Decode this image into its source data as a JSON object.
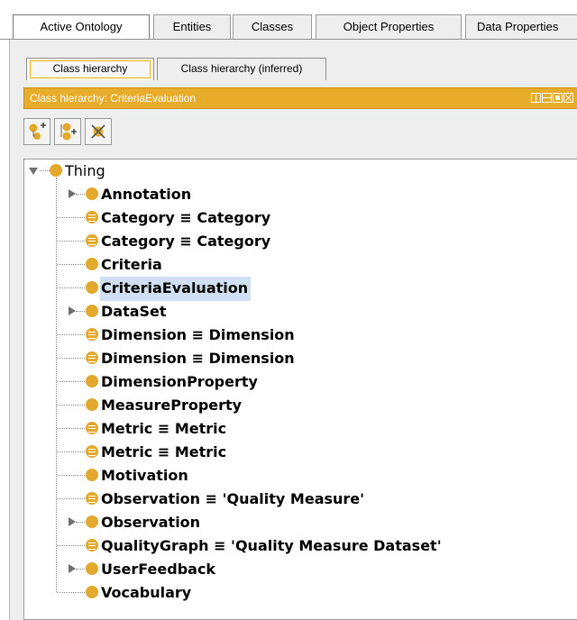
{
  "top_tabs": [
    "Active Ontology",
    "Entities",
    "Classes",
    "Object Properties",
    "Data Properties"
  ],
  "inner_tabs": [
    "Class hierarchy",
    "Class hierarchy (inferred)"
  ],
  "view": {
    "title": "Class hierarchy: CriteriaEvaluation"
  },
  "toolbar": {
    "add_subclass_icon": "add-subclass-icon",
    "add_sibling_icon": "add-sibling-icon",
    "delete_class_icon": "delete-class-icon"
  },
  "colors": {
    "accent": "#e7ac2a",
    "class_dot": "#e2a92c",
    "selection": "#d1dff2"
  },
  "tree": {
    "root": "Thing",
    "children": [
      {
        "label": "Annotation",
        "expandable": true,
        "equivalent": false
      },
      {
        "label": "Category ≡ Category",
        "expandable": false,
        "equivalent": true
      },
      {
        "label": "Category ≡ Category",
        "expandable": false,
        "equivalent": true
      },
      {
        "label": "Criteria",
        "expandable": false,
        "equivalent": false
      },
      {
        "label": "CriteriaEvaluation",
        "expandable": false,
        "equivalent": false,
        "selected": true
      },
      {
        "label": "DataSet",
        "expandable": true,
        "equivalent": false
      },
      {
        "label": "Dimension ≡ Dimension",
        "expandable": false,
        "equivalent": true
      },
      {
        "label": "Dimension ≡ Dimension",
        "expandable": false,
        "equivalent": true
      },
      {
        "label": "DimensionProperty",
        "expandable": false,
        "equivalent": false
      },
      {
        "label": "MeasureProperty",
        "expandable": false,
        "equivalent": false
      },
      {
        "label": "Metric ≡ Metric",
        "expandable": false,
        "equivalent": true
      },
      {
        "label": "Metric ≡ Metric",
        "expandable": false,
        "equivalent": true
      },
      {
        "label": "Motivation",
        "expandable": false,
        "equivalent": false
      },
      {
        "label": "Observation ≡ 'Quality Measure'",
        "expandable": false,
        "equivalent": true
      },
      {
        "label": "Observation",
        "expandable": true,
        "equivalent": false
      },
      {
        "label": "QualityGraph ≡ 'Quality Measure Dataset'",
        "expandable": false,
        "equivalent": true
      },
      {
        "label": "UserFeedback",
        "expandable": true,
        "equivalent": false
      },
      {
        "label": "Vocabulary",
        "expandable": false,
        "equivalent": false
      }
    ]
  }
}
